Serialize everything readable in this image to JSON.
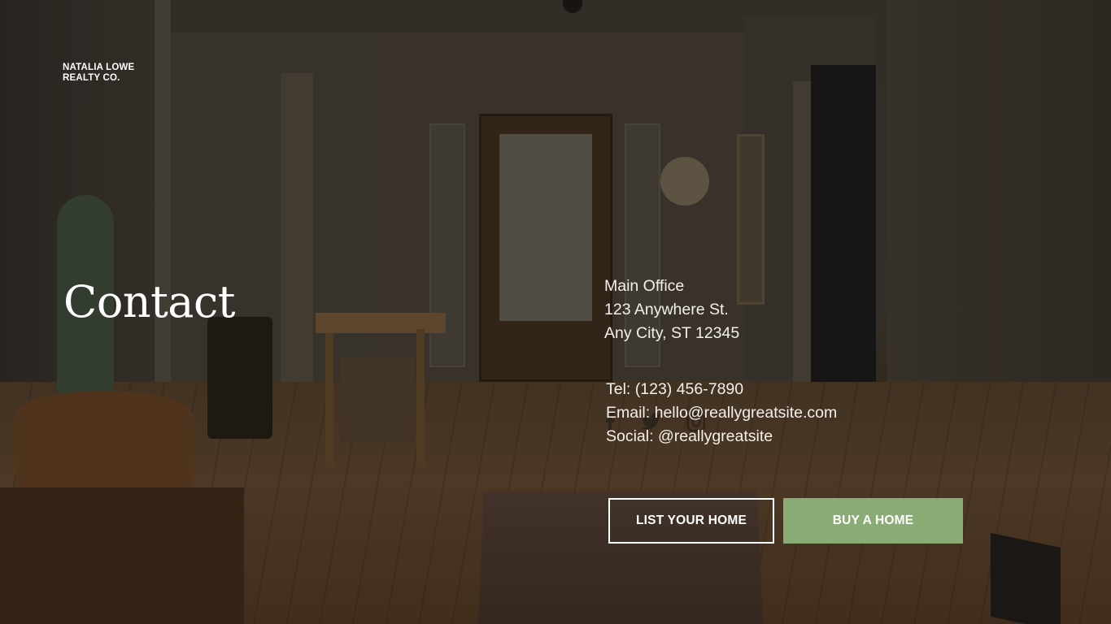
{
  "brand": {
    "line1": "NATALIA LOWE",
    "line2": "REALTY CO."
  },
  "page_title": "Contact",
  "office": {
    "name": "Main Office",
    "street": "123 Anywhere St.",
    "city": "Any City, ST 12345"
  },
  "contact": {
    "tel": "Tel: (123) 456-7890",
    "email": "Email: hello@reallygreatsite.com",
    "social": "Social: @reallygreatsite"
  },
  "social_icons": [
    "facebook-icon",
    "twitter-icon",
    "instagram-icon"
  ],
  "buttons": {
    "list_label": "LIST YOUR HOME",
    "buy_label": "BUY A HOME"
  },
  "colors": {
    "accent_green": "#8aab73",
    "text": "#ffffff"
  }
}
